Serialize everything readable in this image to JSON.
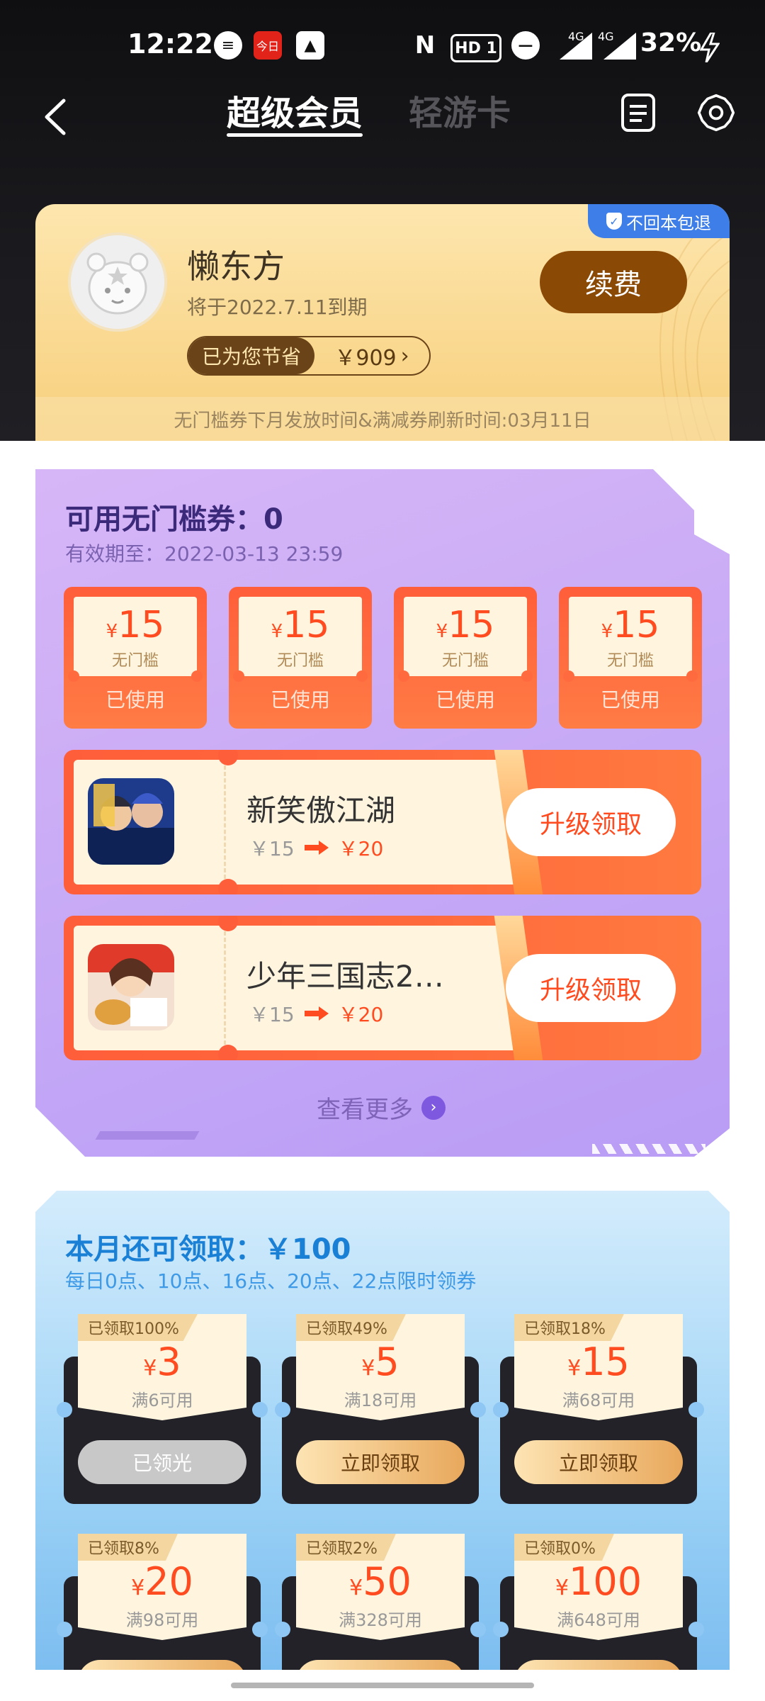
{
  "status_bar": {
    "time": "12:22",
    "network_badge": "HD 1",
    "signal1": "4G",
    "signal2": "4G",
    "battery": "32%"
  },
  "header": {
    "tab_active": "超级会员",
    "tab_inactive": "轻游卡"
  },
  "member": {
    "badge": "不回本包退",
    "name": "懒东方",
    "expire": "将于2022.7.11到期",
    "saved_label": "已为您节省",
    "saved_value": "￥909",
    "renew_button": "续费",
    "note": "无门槛券下月发放时间&满减券刷新时间:03月11日"
  },
  "no_threshold": {
    "title": "可用无门槛券：0",
    "validity": "有效期至：2022-03-13 23:59",
    "coupons": [
      {
        "currency": "¥",
        "amount": "15",
        "label": "无门槛",
        "status": "已使用"
      },
      {
        "currency": "¥",
        "amount": "15",
        "label": "无门槛",
        "status": "已使用"
      },
      {
        "currency": "¥",
        "amount": "15",
        "label": "无门槛",
        "status": "已使用"
      },
      {
        "currency": "¥",
        "amount": "15",
        "label": "无门槛",
        "status": "已使用"
      }
    ],
    "games": [
      {
        "name": "新笑傲江湖",
        "old_price": "￥15",
        "new_price": "￥20",
        "button": "升级领取"
      },
      {
        "name": "少年三国志2-...",
        "old_price": "￥15",
        "new_price": "￥20",
        "button": "升级领取"
      }
    ],
    "more": "查看更多"
  },
  "monthly": {
    "title": "本月还可领取：￥100",
    "subtitle": "每日0点、10点、16点、20点、22点限时领券",
    "coupons": [
      {
        "tag": "已领取100%",
        "currency": "¥",
        "amount": "3",
        "cond": "满6可用",
        "button": "已领光",
        "style": "gray"
      },
      {
        "tag": "已领取49%",
        "currency": "¥",
        "amount": "5",
        "cond": "满18可用",
        "button": "立即领取",
        "style": "gold"
      },
      {
        "tag": "已领取18%",
        "currency": "¥",
        "amount": "15",
        "cond": "满68可用",
        "button": "立即领取",
        "style": "gold"
      },
      {
        "tag": "已领取8%",
        "currency": "¥",
        "amount": "20",
        "cond": "满98可用",
        "button": "",
        "style": "gold"
      },
      {
        "tag": "已领取2%",
        "currency": "¥",
        "amount": "50",
        "cond": "满328可用",
        "button": "",
        "style": "gold"
      },
      {
        "tag": "已领取0%",
        "currency": "¥",
        "amount": "100",
        "cond": "满648可用",
        "button": "",
        "style": "gold"
      }
    ]
  }
}
